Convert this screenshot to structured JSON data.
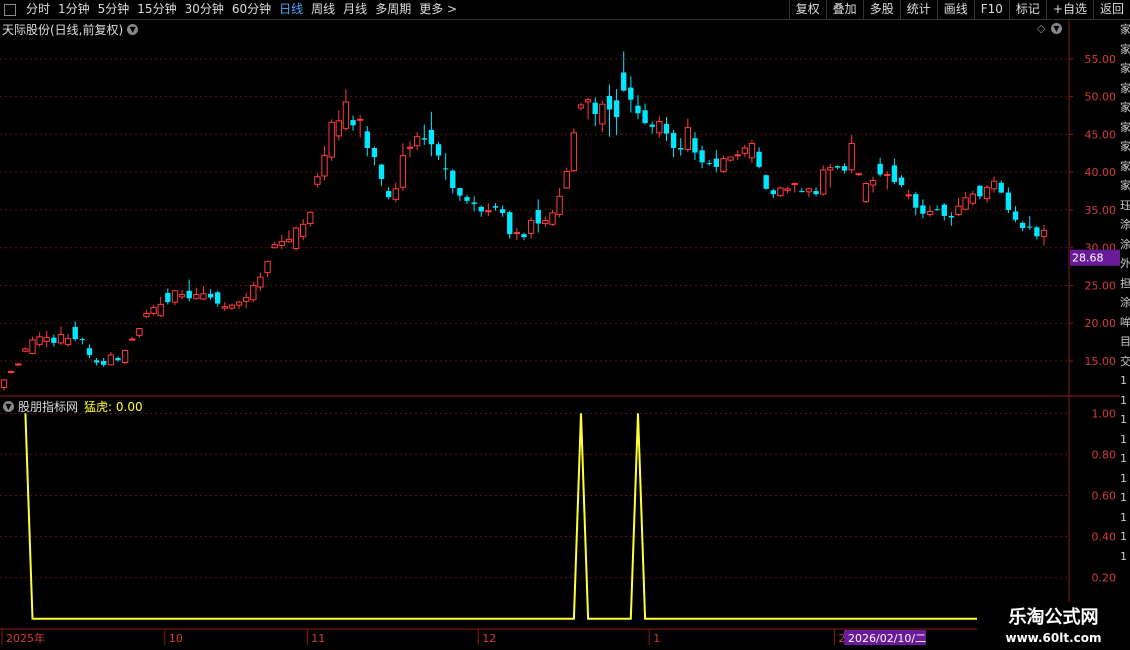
{
  "toolbar": {
    "left_items": [
      "分时",
      "1分钟",
      "5分钟",
      "15分钟",
      "30分钟",
      "60分钟",
      "日线",
      "周线",
      "月线",
      "多周期",
      "更多 >"
    ],
    "active": "日线",
    "right_items": [
      "复权",
      "叠加",
      "多股",
      "统计",
      "画线",
      "F10",
      "标记",
      "+自选",
      "返回"
    ]
  },
  "chart_title": "天际股份(日线,前复权)",
  "indicator": {
    "name": "股朋指标网",
    "label": "猛虎: 0.00"
  },
  "current_price_tag": "28.68",
  "date_label": "2026/02/10/二",
  "watermark": {
    "line1": "乐淘公式网",
    "line2": "www.60lt.com"
  },
  "right_strip_chars": [
    "家",
    "家",
    "家",
    "家",
    "家",
    "家",
    "家",
    "家",
    "家",
    "珏",
    "涂",
    "涂",
    "外",
    "担",
    "涂",
    "哞",
    "目",
    "交",
    "1",
    "1",
    "1",
    "1",
    "1",
    "1",
    "1",
    "1",
    "1",
    "1"
  ],
  "chart_data": [
    {
      "type": "candlestick",
      "title": "天际股份(日线,前复权)",
      "y_ticks": [
        "55.00",
        "50.00",
        "45.00",
        "40.00",
        "35.00",
        "30.00",
        "25.00",
        "20.00",
        "15.00"
      ],
      "ylim": [
        10.5,
        57.5
      ],
      "x_ticks": [
        "2025年",
        "10",
        "11",
        "12",
        "1",
        "2"
      ],
      "last_price": 28.68,
      "up_color": "#ff3c3c",
      "down_color": "#00e8ff",
      "candles": [
        [
          11.5,
          12.5,
          11.1,
          12.6
        ],
        [
          13.6,
          13.6,
          13.5,
          13.8
        ],
        [
          14.6,
          14.6,
          14.5,
          14.8
        ],
        [
          16.3,
          16.6,
          16.2,
          16.8
        ],
        [
          16.0,
          17.8,
          15.9,
          18.2
        ],
        [
          17.2,
          18.2,
          16.9,
          18.8
        ],
        [
          17.6,
          18.1,
          16.8,
          19.0
        ],
        [
          18.1,
          17.4,
          16.9,
          18.5
        ],
        [
          17.4,
          18.5,
          17.1,
          19.6
        ],
        [
          17.2,
          18.0,
          16.9,
          18.6
        ],
        [
          19.5,
          17.9,
          17.6,
          20.2
        ],
        [
          17.9,
          17.8,
          17.2,
          18.1
        ],
        [
          16.7,
          15.8,
          15.4,
          17.2
        ],
        [
          15.1,
          14.8,
          14.4,
          15.4
        ],
        [
          15.0,
          14.5,
          14.2,
          15.4
        ],
        [
          14.5,
          15.8,
          14.4,
          16.2
        ],
        [
          15.4,
          15.1,
          14.9,
          15.6
        ],
        [
          14.8,
          16.4,
          14.6,
          16.5
        ],
        [
          17.9,
          17.9,
          17.7,
          18.2
        ],
        [
          18.4,
          19.3,
          18.1,
          19.3
        ],
        [
          20.9,
          21.3,
          20.7,
          21.8
        ],
        [
          21.3,
          22.1,
          21.0,
          22.4
        ],
        [
          21.0,
          22.5,
          20.8,
          23.5
        ],
        [
          24.0,
          22.8,
          22.5,
          24.6
        ],
        [
          22.8,
          24.3,
          22.4,
          24.4
        ],
        [
          23.5,
          23.8,
          23.2,
          24.4
        ],
        [
          24.3,
          23.3,
          22.9,
          25.8
        ],
        [
          23.3,
          23.8,
          23.1,
          24.7
        ],
        [
          23.2,
          23.9,
          23.1,
          24.9
        ],
        [
          23.9,
          23.4,
          23.1,
          24.5
        ],
        [
          24.1,
          22.6,
          22.2,
          24.3
        ],
        [
          22.0,
          22.2,
          21.6,
          22.8
        ],
        [
          22.0,
          22.4,
          21.8,
          22.6
        ],
        [
          22.4,
          22.8,
          21.9,
          23.0
        ],
        [
          22.9,
          23.4,
          22.0,
          24.0
        ],
        [
          23.1,
          25.0,
          22.8,
          25.5
        ],
        [
          24.8,
          26.1,
          24.3,
          26.7
        ],
        [
          26.7,
          28.2,
          26.1,
          28.2
        ],
        [
          30.0,
          30.4,
          29.9,
          30.8
        ],
        [
          30.3,
          30.8,
          29.8,
          31.7
        ],
        [
          30.8,
          31.1,
          30.6,
          32.3
        ],
        [
          29.9,
          32.6,
          29.6,
          32.8
        ],
        [
          31.5,
          33.1,
          31.0,
          33.8
        ],
        [
          33.2,
          34.7,
          32.8,
          34.8
        ],
        [
          38.4,
          39.4,
          38.0,
          39.9
        ],
        [
          39.5,
          42.2,
          38.9,
          43.5
        ],
        [
          42.0,
          46.6,
          41.5,
          47.0
        ],
        [
          44.8,
          46.8,
          44.2,
          48.2
        ],
        [
          45.8,
          49.3,
          45.5,
          51.0
        ],
        [
          46.9,
          46.2,
          45.5,
          47.5
        ],
        [
          46.9,
          47.0,
          44.6,
          47.6
        ],
        [
          45.4,
          43.2,
          42.1,
          46.1
        ],
        [
          43.2,
          42.0,
          40.9,
          43.4
        ],
        [
          41.0,
          39.1,
          38.2,
          41.1
        ],
        [
          37.5,
          36.7,
          36.4,
          38.0
        ],
        [
          36.4,
          37.8,
          36.0,
          38.6
        ],
        [
          38.0,
          42.2,
          37.5,
          43.8
        ],
        [
          43.3,
          43.3,
          42.0,
          44.1
        ],
        [
          43.5,
          44.7,
          42.9,
          45.3
        ],
        [
          44.5,
          44.3,
          43.6,
          46.3
        ],
        [
          45.6,
          43.7,
          42.1,
          48.0
        ],
        [
          43.7,
          42.2,
          41.6,
          44.0
        ],
        [
          40.5,
          40.4,
          39.0,
          42.5
        ],
        [
          40.2,
          37.9,
          37.2,
          40.4
        ],
        [
          37.9,
          36.9,
          36.2,
          37.9
        ],
        [
          36.7,
          36.2,
          35.8,
          37.0
        ],
        [
          36.0,
          35.8,
          34.8,
          36.8
        ],
        [
          35.4,
          34.8,
          34.1,
          35.6
        ],
        [
          34.9,
          34.9,
          34.2,
          35.9
        ],
        [
          35.5,
          35.3,
          34.9,
          35.9
        ],
        [
          35.1,
          34.6,
          34.1,
          35.6
        ],
        [
          34.7,
          31.8,
          31.2,
          34.9
        ],
        [
          32.0,
          32.0,
          31.0,
          32.6
        ],
        [
          31.8,
          31.4,
          31.0,
          32.0
        ],
        [
          31.9,
          33.6,
          31.2,
          34.0
        ],
        [
          35.0,
          33.2,
          32.0,
          36.4
        ],
        [
          33.2,
          33.6,
          32.8,
          34.1
        ],
        [
          33.1,
          34.6,
          32.9,
          35.0
        ],
        [
          34.4,
          36.8,
          34.0,
          37.9
        ],
        [
          37.9,
          40.1,
          37.8,
          40.6
        ],
        [
          40.2,
          45.2,
          40.0,
          45.8
        ],
        [
          48.5,
          48.9,
          48.2,
          49.2
        ],
        [
          49.3,
          49.6,
          47.0,
          49.9
        ],
        [
          49.2,
          47.7,
          46.1,
          49.9
        ],
        [
          46.4,
          49.0,
          45.3,
          49.5
        ],
        [
          50.1,
          48.3,
          44.7,
          51.6
        ],
        [
          49.5,
          47.3,
          44.9,
          51.0
        ],
        [
          53.2,
          50.8,
          50.7,
          56.0
        ],
        [
          51.2,
          49.6,
          47.9,
          52.7
        ],
        [
          48.8,
          47.8,
          47.0,
          50.2
        ],
        [
          48.2,
          46.5,
          46.3,
          49.1
        ],
        [
          46.3,
          46.0,
          45.1,
          46.7
        ],
        [
          45.2,
          46.7,
          44.6,
          47.4
        ],
        [
          46.4,
          45.1,
          44.1,
          47.3
        ],
        [
          45.2,
          43.2,
          42.0,
          45.6
        ],
        [
          43.2,
          43.0,
          42.2,
          44.5
        ],
        [
          43.0,
          45.9,
          42.7,
          47.1
        ],
        [
          44.5,
          42.6,
          41.6,
          45.3
        ],
        [
          42.9,
          41.3,
          40.5,
          43.5
        ],
        [
          41.2,
          41.1,
          40.9,
          41.6
        ],
        [
          41.8,
          40.7,
          40.0,
          42.9
        ],
        [
          40.1,
          41.8,
          39.9,
          42.2
        ],
        [
          41.6,
          42.0,
          41.4,
          42.0
        ],
        [
          42.2,
          42.3,
          41.6,
          42.9
        ],
        [
          42.5,
          43.2,
          42.0,
          43.6
        ],
        [
          41.9,
          43.8,
          41.2,
          44.3
        ],
        [
          42.7,
          40.7,
          40.5,
          43.3
        ],
        [
          39.6,
          37.8,
          37.7,
          39.7
        ],
        [
          37.6,
          37.1,
          36.6,
          37.8
        ],
        [
          36.9,
          37.9,
          36.7,
          38.1
        ],
        [
          37.6,
          37.8,
          37.2,
          38.1
        ],
        [
          38.4,
          38.5,
          37.3,
          38.6
        ],
        [
          37.5,
          37.4,
          37.3,
          37.9
        ],
        [
          37.4,
          37.8,
          36.7,
          37.9
        ],
        [
          37.5,
          37.1,
          36.8,
          38.0
        ],
        [
          37.1,
          40.3,
          36.9,
          40.9
        ],
        [
          40.3,
          40.6,
          38.0,
          41.1
        ],
        [
          40.8,
          40.6,
          40.4,
          40.9
        ],
        [
          40.8,
          40.2,
          39.8,
          41.2
        ],
        [
          40.3,
          43.8,
          39.9,
          44.9
        ],
        [
          39.8,
          39.8,
          39.5,
          39.9
        ],
        [
          36.1,
          38.5,
          35.9,
          38.7
        ],
        [
          38.3,
          38.9,
          37.3,
          39.4
        ],
        [
          41.1,
          39.7,
          39.4,
          41.9
        ],
        [
          39.6,
          39.7,
          37.7,
          40.1
        ],
        [
          40.9,
          38.7,
          38.4,
          41.8
        ],
        [
          39.3,
          38.3,
          38.0,
          39.6
        ],
        [
          36.9,
          37.0,
          36.4,
          37.7
        ],
        [
          37.1,
          35.3,
          34.3,
          37.4
        ],
        [
          35.6,
          34.5,
          33.9,
          36.4
        ],
        [
          34.4,
          34.8,
          34.1,
          35.6
        ],
        [
          35.1,
          35.0,
          34.9,
          35.6
        ],
        [
          35.7,
          34.2,
          33.6,
          35.9
        ],
        [
          34.2,
          34.0,
          32.9,
          34.7
        ],
        [
          34.4,
          35.5,
          34.2,
          36.6
        ],
        [
          35.1,
          36.6,
          35.0,
          37.4
        ],
        [
          35.9,
          37.1,
          35.6,
          37.5
        ],
        [
          38.2,
          36.8,
          36.4,
          38.3
        ],
        [
          36.5,
          38.0,
          36.0,
          38.3
        ],
        [
          37.8,
          38.8,
          37.3,
          39.4
        ],
        [
          38.6,
          37.3,
          37.2,
          38.9
        ],
        [
          37.3,
          35.0,
          34.6,
          38.0
        ],
        [
          34.8,
          33.7,
          33.4,
          35.5
        ],
        [
          33.3,
          32.6,
          32.2,
          33.5
        ],
        [
          32.8,
          32.7,
          32.4,
          34.2
        ],
        [
          32.7,
          31.5,
          31.1,
          32.9
        ],
        [
          31.5,
          32.3,
          30.3,
          33.0
        ]
      ]
    },
    {
      "type": "line",
      "series": [
        {
          "name": "猛虎",
          "values": [
            1,
            0,
            0,
            0,
            0,
            0,
            0,
            0,
            0,
            0,
            0,
            0,
            0,
            0,
            0,
            0,
            0,
            0,
            0,
            0,
            0,
            0,
            0,
            0,
            0,
            0,
            0,
            0,
            0,
            0,
            0,
            0,
            0,
            0,
            0,
            0,
            0,
            0,
            0,
            0,
            0,
            0,
            0,
            0,
            0,
            0,
            0,
            0,
            0,
            0,
            0,
            0,
            0,
            0,
            0,
            0,
            0,
            0,
            0,
            0,
            0,
            0,
            0,
            0,
            0,
            0,
            0,
            0,
            0,
            0,
            0,
            0,
            0,
            0,
            0,
            0,
            0,
            0,
            1,
            0,
            0,
            0,
            0,
            0,
            0,
            0,
            1,
            0,
            0,
            0,
            0,
            0,
            0,
            0,
            0,
            0,
            0,
            0,
            0,
            0,
            0,
            0,
            0,
            0,
            0,
            0,
            0,
            0,
            0,
            0,
            0,
            0,
            0,
            0,
            0,
            0,
            0,
            0,
            0,
            0,
            0,
            0,
            0,
            0,
            0,
            0,
            0,
            0,
            0,
            0,
            0,
            0,
            0,
            0,
            0,
            0,
            0,
            0,
            0,
            0,
            0,
            0,
            0,
            0,
            0,
            0,
            0,
            0
          ]
        }
      ],
      "y_ticks": [
        "1.00",
        "0.80",
        "0.60",
        "0.40",
        "0.20"
      ],
      "ylim": [
        -0.045,
        1.065
      ],
      "color": "#ffff33"
    }
  ]
}
